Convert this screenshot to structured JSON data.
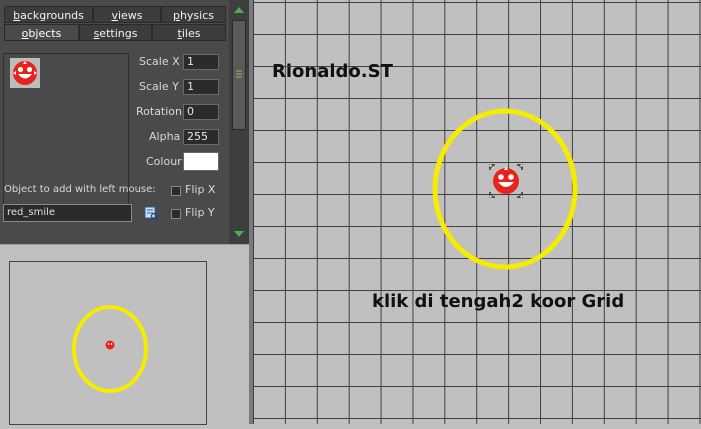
{
  "tabs": {
    "row1": [
      {
        "pre": "",
        "ul": "b",
        "post": "ackgrounds"
      },
      {
        "pre": "",
        "ul": "v",
        "post": "iews"
      },
      {
        "pre": "",
        "ul": "p",
        "post": "hysics"
      }
    ],
    "row2": [
      {
        "pre": "",
        "ul": "o",
        "post": "bjects"
      },
      {
        "pre": "",
        "ul": "s",
        "post": "ettings"
      },
      {
        "pre": "",
        "ul": "t",
        "post": "iles"
      }
    ]
  },
  "properties": {
    "scale_x_label": "Scale X",
    "scale_x": "1",
    "scale_y_label": "Scale Y",
    "scale_y": "1",
    "rotation_label": "Rotation",
    "rotation": "0",
    "alpha_label": "Alpha",
    "alpha": "255",
    "colour_label": "Colour",
    "colour_value": "#ffffff"
  },
  "object_add": {
    "label": "Object to add with left mouse:",
    "value": "red_smile",
    "flip_x_label": "Flip X",
    "flip_y_label": "Flip Y"
  },
  "room": {
    "watermark": "Rionaldo.ST",
    "instruction": "klik di tengah2 koor Grid"
  },
  "colors": {
    "highlight_ellipse": "#f5ec00",
    "sprite_red": "#e8231e",
    "grid_line": "#404040",
    "canvas_bg": "#c0c0c0"
  },
  "icons": [
    "red-smile-sprite-icon",
    "browse-object-icon",
    "scroll-up-arrow-icon",
    "scroll-down-arrow-icon"
  ]
}
